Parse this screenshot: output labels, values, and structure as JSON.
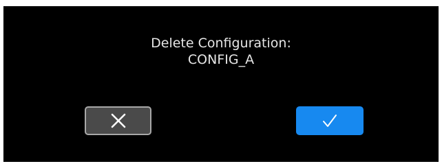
{
  "dialog": {
    "title_line1": "Delete Configuration:",
    "title_line2": "CONFIG_A"
  },
  "buttons": {
    "cancel": {
      "icon": "close-icon",
      "color": "#4a4a4a",
      "border": "#a8a8a8"
    },
    "confirm": {
      "icon": "checkmark-icon",
      "color": "#1789f0"
    }
  },
  "colors": {
    "background": "#000000",
    "text": "#e6e6e6"
  }
}
